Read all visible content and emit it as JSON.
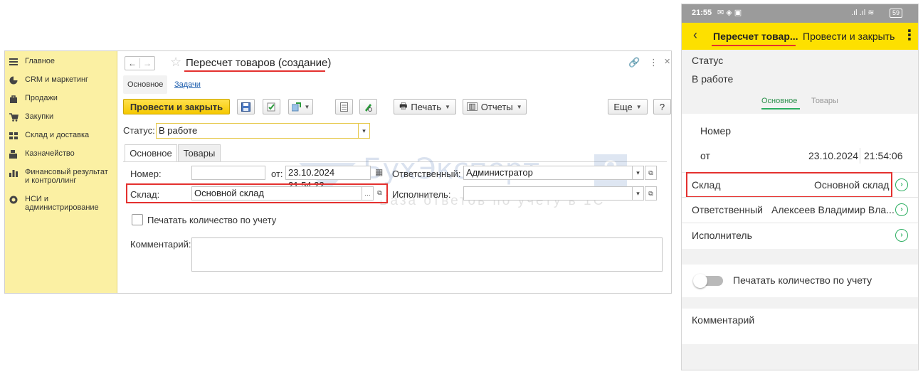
{
  "desktop": {
    "sidebar": [
      {
        "icon": "menu-icon",
        "label": "Главное"
      },
      {
        "icon": "crm-pie-icon",
        "label": "CRM и маркетинг"
      },
      {
        "icon": "bag-icon",
        "label": "Продажи"
      },
      {
        "icon": "cart-icon",
        "label": "Закупки"
      },
      {
        "icon": "warehouse-icon",
        "label": "Склад и доставка"
      },
      {
        "icon": "cash-register-icon",
        "label": "Казначейство"
      },
      {
        "icon": "bar-chart-icon",
        "label": "Финансовый результат и контроллинг"
      },
      {
        "icon": "gear-icon",
        "label": "НСИ и администрирование"
      }
    ],
    "title": "Пересчет товаров (создание)",
    "nav": {
      "back": "←",
      "forward": "→"
    },
    "tabs_top": {
      "main": "Основное",
      "link": "Задачи"
    },
    "toolbar": {
      "post_close": "Провести и закрыть",
      "print": "Печать",
      "reports": "Отчеты",
      "more": "Еще",
      "help": "?"
    },
    "status": {
      "label": "Статус:",
      "value": "В работе"
    },
    "tabs": [
      "Основное",
      "Товары"
    ],
    "fields": {
      "number_label": "Номер:",
      "number_value": "",
      "date_label": "от:",
      "date_value": "23.10.2024 21:54:22",
      "responsible_label": "Ответственный:",
      "responsible_value": "Администратор",
      "warehouse_label": "Склад:",
      "warehouse_value": "Основной склад",
      "executor_label": "Исполнитель:",
      "executor_value": "",
      "print_qty_label": "Печатать количество по учету",
      "comment_label": "Комментарий:"
    },
    "watermark": {
      "brand": "БухЭксперт",
      "number": "8",
      "tagline": "База ответов по учету в 1С"
    }
  },
  "phone": {
    "statusbar": {
      "time": "21:55",
      "battery": "59"
    },
    "appbar": {
      "title": "Пересчет товар...",
      "action": "Провести и закрыть"
    },
    "status_label": "Статус",
    "status_value": "В работе",
    "tabs": [
      "Основное",
      "Товары"
    ],
    "number_label": "Номер",
    "date_label": "от",
    "date_value": "23.10.2024",
    "time_value": "21:54:06",
    "warehouse_label": "Склад",
    "warehouse_value": "Основной склад",
    "responsible_label": "Ответственный",
    "responsible_value": "Алексеев Владимир Вла...",
    "executor_label": "Исполнитель",
    "print_qty_label": "Печатать количество по учету",
    "comment_label": "Комментарий"
  },
  "colors": {
    "accent_yellow": "#fde000",
    "sidebar": "#fbf0a3",
    "highlight_red": "#e4312f",
    "green": "#2bae60"
  }
}
